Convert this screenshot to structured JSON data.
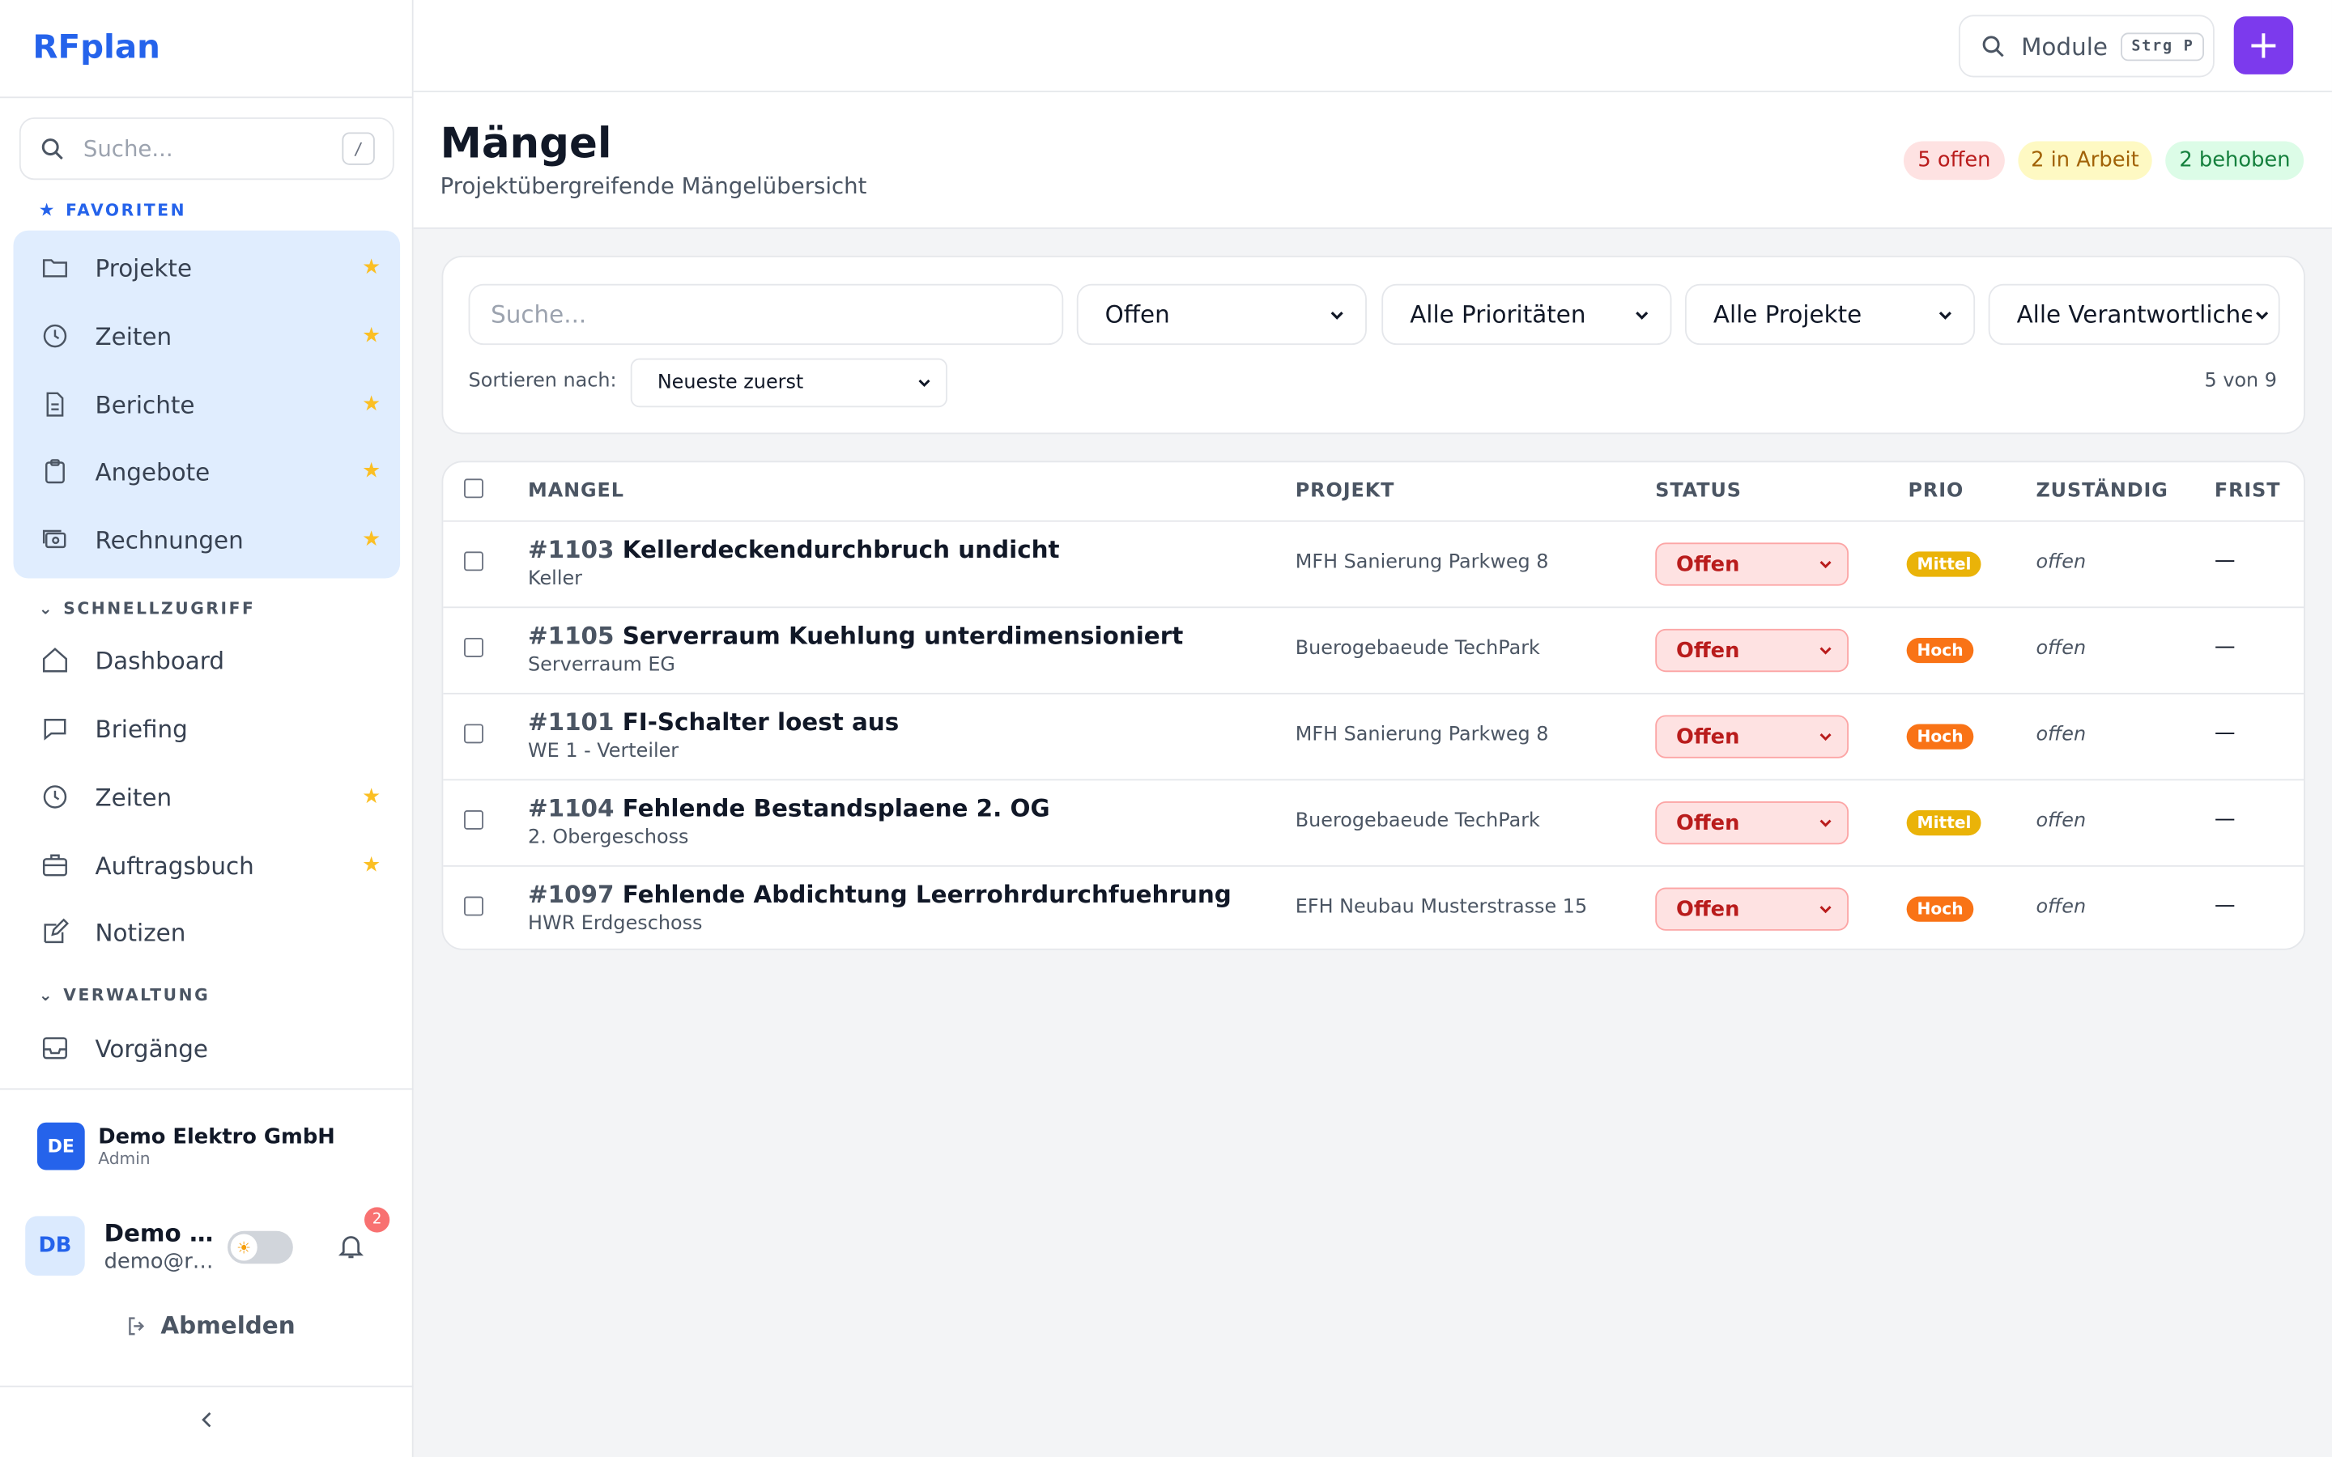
{
  "brand": "RFplan",
  "sidebar": {
    "search_placeholder": "Suche...",
    "search_shortcut": "/",
    "favorites_label": "FAVORITEN",
    "favorites": [
      {
        "label": "Projekte",
        "icon": "folder-icon"
      },
      {
        "label": "Zeiten",
        "icon": "clock-icon"
      },
      {
        "label": "Berichte",
        "icon": "document-icon"
      },
      {
        "label": "Angebote",
        "icon": "clipboard-icon"
      },
      {
        "label": "Rechnungen",
        "icon": "cash-icon"
      }
    ],
    "quick_label": "SCHNELLZUGRIFF",
    "quick": [
      {
        "label": "Dashboard",
        "icon": "home-icon",
        "starred": false
      },
      {
        "label": "Briefing",
        "icon": "chat-icon",
        "starred": false
      },
      {
        "label": "Zeiten",
        "icon": "clock-icon",
        "starred": true
      },
      {
        "label": "Auftragsbuch",
        "icon": "briefcase-icon",
        "starred": true
      },
      {
        "label": "Notizen",
        "icon": "edit-icon",
        "starred": false
      }
    ],
    "admin_label": "VERWALTUNG",
    "admin": [
      {
        "label": "Vorgänge",
        "icon": "inbox-icon"
      }
    ],
    "org": {
      "initials": "DE",
      "name": "Demo Elektro GmbH",
      "role": "Admin"
    },
    "user": {
      "initials": "DB",
      "name": "Demo Benutzer",
      "email": "demo@rfplan.de",
      "notifications": "2"
    },
    "logout": "Abmelden"
  },
  "topbar": {
    "module_label": "Module",
    "module_shortcut": "Strg P",
    "add_label": "+"
  },
  "page": {
    "title": "Mängel",
    "subtitle": "Projektübergreifende Mängelübersicht",
    "pills": [
      {
        "label": "5 offen",
        "bg": "#fee2e2",
        "fg": "#b91c1c"
      },
      {
        "label": "2 in Arbeit",
        "bg": "#fef9c3",
        "fg": "#a16207"
      },
      {
        "label": "2 behoben",
        "bg": "#dcfce7",
        "fg": "#15803d"
      }
    ]
  },
  "filters": {
    "search_placeholder": "Suche...",
    "status": "Offen",
    "priority": "Alle Prioritäten",
    "project": "Alle Projekte",
    "responsible": "Alle Verantwortlichen",
    "sort_label": "Sortieren nach:",
    "sort_value": "Neueste zuerst",
    "count": "5 von 9"
  },
  "table": {
    "headers": {
      "defect": "MANGEL",
      "project": "PROJEKT",
      "status": "STATUS",
      "prio": "PRIO",
      "responsible": "ZUSTÄNDIG",
      "due": "FRIST"
    },
    "rows": [
      {
        "id": "#1103",
        "title": "Kellerdeckendurchbruch undicht",
        "location": "Keller",
        "project": "MFH Sanierung Parkweg 8",
        "status": "Offen",
        "prio": "Mittel",
        "prio_color": "#eab308",
        "responsible": "offen",
        "due": "—"
      },
      {
        "id": "#1105",
        "title": "Serverraum Kuehlung unterdimensioniert",
        "location": "Serverraum EG",
        "project": "Buerogebaeude TechPark",
        "status": "Offen",
        "prio": "Hoch",
        "prio_color": "#f97316",
        "responsible": "offen",
        "due": "—"
      },
      {
        "id": "#1101",
        "title": "FI-Schalter loest aus",
        "location": "WE 1 - Verteiler",
        "project": "MFH Sanierung Parkweg 8",
        "status": "Offen",
        "prio": "Hoch",
        "prio_color": "#f97316",
        "responsible": "offen",
        "due": "—"
      },
      {
        "id": "#1104",
        "title": "Fehlende Bestandsplaene 2. OG",
        "location": "2. Obergeschoss",
        "project": "Buerogebaeude TechPark",
        "status": "Offen",
        "prio": "Mittel",
        "prio_color": "#eab308",
        "responsible": "offen",
        "due": "—"
      },
      {
        "id": "#1097",
        "title": "Fehlende Abdichtung Leerrohrdurchfuehrung",
        "location": "HWR Erdgeschoss",
        "project": "EFH Neubau Musterstrasse 15",
        "status": "Offen",
        "prio": "Hoch",
        "prio_color": "#f97316",
        "responsible": "offen",
        "due": "—"
      }
    ]
  }
}
